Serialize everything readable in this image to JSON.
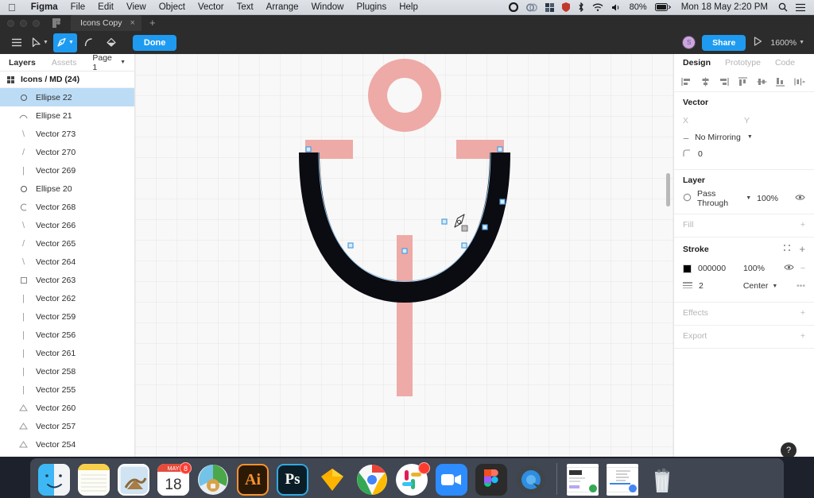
{
  "menubar": {
    "apple_icon": "apple-icon",
    "items": [
      "Figma",
      "File",
      "Edit",
      "View",
      "Object",
      "Vector",
      "Text",
      "Arrange",
      "Window",
      "Plugins",
      "Help"
    ],
    "status_icons": [
      "record-icon",
      "screen-share-icon",
      "dropbox-icon",
      "shield-icon",
      "bluetooth-icon",
      "wifi-icon",
      "volume-icon"
    ],
    "battery_percent": "80%",
    "clock": "Mon 18 May  2:20 PM",
    "search_icon": "search-icon",
    "control-center_icon": "control-center-icon"
  },
  "window": {
    "tab_title": "Icons Copy",
    "tab_close": "×",
    "tab_add": "+"
  },
  "toolbar": {
    "menu_icon": "hamburger-menu-icon",
    "move_tool": "move-tool-icon",
    "pen_tool": "pen-tool-icon",
    "bend_tool": "bend-tool-icon",
    "paint_bucket_tool": "paint-bucket-icon",
    "done_label": "Done",
    "avatar_initial": "S",
    "share_label": "Share",
    "present_icon": "present-play-icon",
    "zoom_level": "1600%"
  },
  "left_panel": {
    "tabs": [
      {
        "label": "Layers",
        "selected": true
      },
      {
        "label": "Assets",
        "selected": false
      }
    ],
    "page_selector": "Page 1",
    "group": {
      "label": "Icons / MD (24)",
      "icon": "component-grid-icon"
    },
    "layers": [
      {
        "name": "Ellipse 22",
        "icon": "ellipse-icon",
        "selected": true
      },
      {
        "name": "Ellipse 21",
        "icon": "arc-icon",
        "selected": false
      },
      {
        "name": "Vector 273",
        "icon": "line-icon",
        "selected": false
      },
      {
        "name": "Vector 270",
        "icon": "line-icon",
        "selected": false
      },
      {
        "name": "Vector 269",
        "icon": "line-icon",
        "selected": false
      },
      {
        "name": "Ellipse 20",
        "icon": "ellipse-icon",
        "selected": false
      },
      {
        "name": "Vector 268",
        "icon": "arc-icon",
        "selected": false
      },
      {
        "name": "Vector 266",
        "icon": "line-icon",
        "selected": false
      },
      {
        "name": "Vector 265",
        "icon": "line-icon",
        "selected": false
      },
      {
        "name": "Vector 264",
        "icon": "line-icon",
        "selected": false
      },
      {
        "name": "Vector 263",
        "icon": "square-icon",
        "selected": false
      },
      {
        "name": "Vector 262",
        "icon": "line-icon",
        "selected": false
      },
      {
        "name": "Vector 259",
        "icon": "line-icon",
        "selected": false
      },
      {
        "name": "Vector 256",
        "icon": "line-icon",
        "selected": false
      },
      {
        "name": "Vector 261",
        "icon": "line-icon",
        "selected": false
      },
      {
        "name": "Vector 258",
        "icon": "line-icon",
        "selected": false
      },
      {
        "name": "Vector 255",
        "icon": "line-icon",
        "selected": false
      },
      {
        "name": "Vector 260",
        "icon": "triangle-icon",
        "selected": false
      },
      {
        "name": "Vector 257",
        "icon": "triangle-icon",
        "selected": false
      },
      {
        "name": "Vector 254",
        "icon": "triangle-icon",
        "selected": false
      }
    ]
  },
  "canvas": {
    "icon_name": "anchor-icon-artwork",
    "shape_color": "#eeaaa6",
    "stroke_color": "#0b0b12",
    "vertex_color": "#a8d6f5",
    "cursor": "pen-tool-cursor"
  },
  "right_panel": {
    "tabs": [
      {
        "label": "Design",
        "selected": true
      },
      {
        "label": "Prototype",
        "selected": false
      },
      {
        "label": "Code",
        "selected": false
      }
    ],
    "align_icons": [
      "align-left-icon",
      "align-horizontal-center-icon",
      "align-right-icon",
      "align-top-icon",
      "align-vertical-center-icon",
      "align-bottom-icon",
      "distribute-icon"
    ],
    "vector": {
      "title": "Vector",
      "x_label": "X",
      "x_value": "",
      "y_label": "Y",
      "y_value": "",
      "mirroring": "No Mirroring",
      "corner_radius_icon": "corner-radius-icon",
      "corner_radius": "0"
    },
    "layer": {
      "title": "Layer",
      "blend_icon": "blend-mode-icon",
      "blend_mode": "Pass Through",
      "opacity": "100%",
      "visibility_icon": "eye-icon"
    },
    "fill": {
      "title": "Fill",
      "add_icon": "+"
    },
    "stroke": {
      "title": "Stroke",
      "settings_icon": "stroke-style-icon",
      "add_icon": "+",
      "color_hex": "000000",
      "color_swatch": "#000000",
      "opacity": "100%",
      "visibility_icon": "eye-icon",
      "remove_icon": "−",
      "weight_icon": "stroke-weight-icon",
      "weight": "2",
      "align": "Center",
      "more_icon": "•••"
    },
    "effects": {
      "title": "Effects",
      "add_icon": "+"
    },
    "export": {
      "title": "Export",
      "add_icon": "+"
    },
    "help_label": "?"
  },
  "dock": {
    "items": [
      {
        "name": "finder",
        "label": "Finder"
      },
      {
        "name": "notes",
        "label": "Notes"
      },
      {
        "name": "mail",
        "label": "Mail"
      },
      {
        "name": "calendar",
        "label": "Calendar",
        "month": "MAY",
        "day": "18",
        "badge": "8"
      },
      {
        "name": "safari",
        "label": "Safari"
      },
      {
        "name": "illustrator",
        "label": "Ai"
      },
      {
        "name": "photoshop",
        "label": "Ps"
      },
      {
        "name": "sketch",
        "label": "Sketch"
      },
      {
        "name": "chrome",
        "label": "Chrome"
      },
      {
        "name": "slack",
        "label": "Slack",
        "badge": ""
      },
      {
        "name": "zoom",
        "label": "Zoom"
      },
      {
        "name": "figma",
        "label": "Figma"
      },
      {
        "name": "quicktime",
        "label": "QuickTime"
      },
      {
        "name": "window-thumb-1",
        "label": ""
      },
      {
        "name": "window-thumb-2",
        "label": ""
      },
      {
        "name": "trash",
        "label": "Trash"
      }
    ]
  }
}
